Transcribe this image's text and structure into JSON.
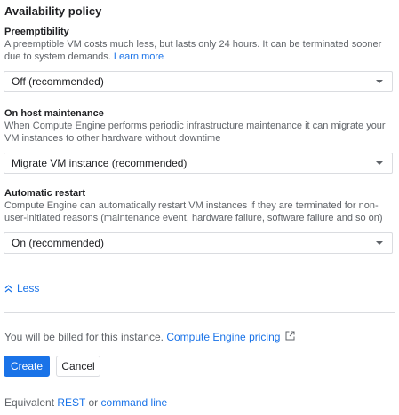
{
  "section_title": "Availability policy",
  "preemptibility": {
    "label": "Preemptibility",
    "desc_line1": "A preemptible VM costs much less, but lasts only 24 hours. It can be terminated sooner",
    "desc_line2_text": "due to system demands. ",
    "learn_more": "Learn more",
    "selected": "Off (recommended)"
  },
  "on_host_maintenance": {
    "label": "On host maintenance",
    "desc_line1": "When Compute Engine performs periodic infrastructure maintenance it can migrate your",
    "desc_line2": "VM instances to other hardware without downtime",
    "selected": "Migrate VM instance (recommended)"
  },
  "automatic_restart": {
    "label": "Automatic restart",
    "desc_line1": "Compute Engine can automatically restart VM instances if they are terminated for non-",
    "desc_line2": "user-initiated reasons (maintenance event, hardware failure, software failure and so on)",
    "selected": "On (recommended)"
  },
  "less_label": "Less",
  "billing": {
    "text": "You will be billed for this instance. ",
    "link": "Compute Engine pricing"
  },
  "buttons": {
    "create": "Create",
    "cancel": "Cancel"
  },
  "equivalent": {
    "prefix": "Equivalent ",
    "rest": "REST",
    "or": " or ",
    "command_line": "command line"
  },
  "colors": {
    "accent": "#1a73e8",
    "border": "#dadce0",
    "muted_text": "#5f6368"
  },
  "icons": {
    "less": "chevron-up-double-icon",
    "external": "external-link-icon",
    "dropdown": "caret-down-icon"
  }
}
